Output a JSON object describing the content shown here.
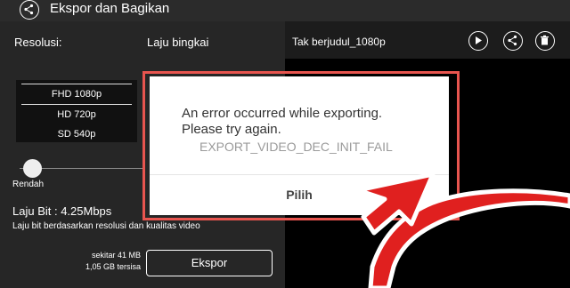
{
  "header": {
    "title": "Ekspor dan Bagikan"
  },
  "settings": {
    "resolution_label": "Resolusi:",
    "framerate_label": "Laju bingkai",
    "resolutions": [
      "FHD 1080p",
      "HD 720p",
      "SD 540p"
    ],
    "quality_label": "Rendah",
    "bitrate_label": "Laju Bit : 4.25Mbps",
    "bitrate_note": "Laju bit berdasarkan resolusi dan kualitas video",
    "size_estimate": "sekitar 41 MB",
    "space_left": "1,05 GB tersisa",
    "export_button": "Ekspor"
  },
  "preview": {
    "title": "Tak berjudul_1080p"
  },
  "dialog": {
    "message_line1": "An error occurred while exporting.",
    "message_line2": "Please try again.",
    "code": "EXPORT_VIDEO_DEC_INIT_FAIL",
    "button": "Pilih"
  },
  "colors": {
    "highlight_red": "#e8554f",
    "arrow_red": "#e0201f"
  }
}
